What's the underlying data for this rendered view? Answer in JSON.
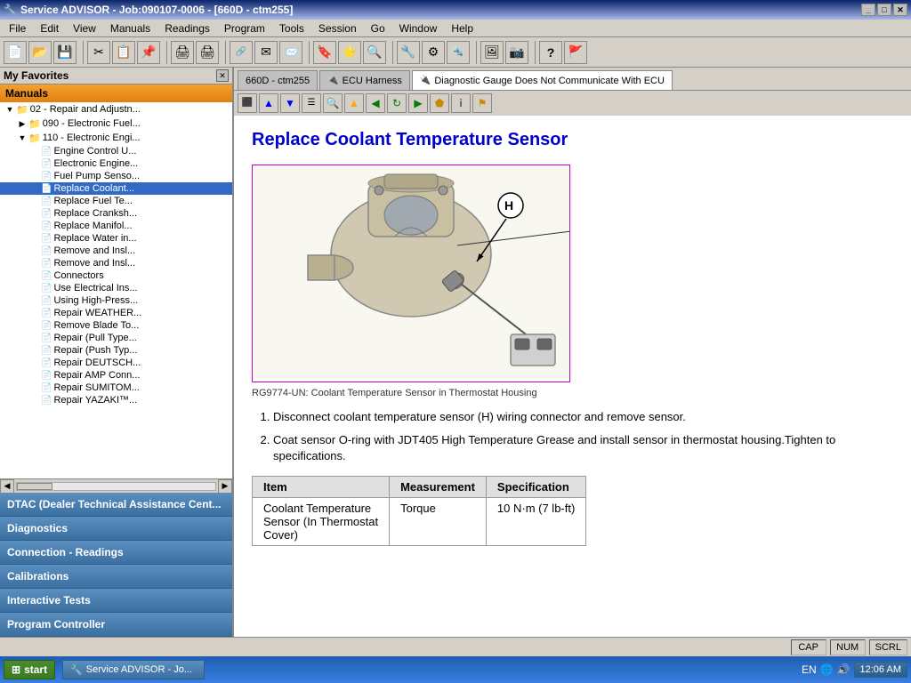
{
  "window": {
    "title": "Service ADVISOR - Job:090107-0006 - [660D - ctm255]",
    "icon": "🔧"
  },
  "menu": {
    "items": [
      "File",
      "Edit",
      "View",
      "Manuals",
      "Readings",
      "Program",
      "Tools",
      "Session",
      "Go",
      "Window",
      "Help"
    ]
  },
  "tabs": [
    {
      "label": "660D - ctm255",
      "active": false
    },
    {
      "label": "ECU Harness",
      "active": false
    },
    {
      "label": "Diagnostic Gauge Does Not Communicate With ECU",
      "active": true
    }
  ],
  "left_panel": {
    "title": "My Favorites",
    "manuals_label": "Manuals",
    "tree": [
      {
        "level": 0,
        "type": "folder",
        "expanded": true,
        "text": "02 - Repair and Adjustn..."
      },
      {
        "level": 1,
        "type": "folder",
        "expanded": false,
        "text": "090 - Electronic Fuel..."
      },
      {
        "level": 1,
        "type": "folder",
        "expanded": true,
        "text": "110 - Electronic Engi..."
      },
      {
        "level": 2,
        "type": "doc",
        "text": "Engine Control U..."
      },
      {
        "level": 2,
        "type": "doc",
        "text": "Electronic Engine..."
      },
      {
        "level": 2,
        "type": "doc",
        "text": "Fuel Pump Senso..."
      },
      {
        "level": 2,
        "type": "doc",
        "text": "Replace Coolant...",
        "selected": true
      },
      {
        "level": 2,
        "type": "doc",
        "text": "Replace Fuel Te..."
      },
      {
        "level": 2,
        "type": "doc",
        "text": "Replace Cranksh..."
      },
      {
        "level": 2,
        "type": "doc",
        "text": "Replace Manifol..."
      },
      {
        "level": 2,
        "type": "doc",
        "text": "Replace Water in..."
      },
      {
        "level": 2,
        "type": "doc",
        "text": "Remove and Insl..."
      },
      {
        "level": 2,
        "type": "doc",
        "text": "Remove and Insl..."
      },
      {
        "level": 2,
        "type": "doc",
        "text": "Connectors"
      },
      {
        "level": 2,
        "type": "doc",
        "text": "Use Electrical Ins..."
      },
      {
        "level": 2,
        "type": "doc",
        "text": "Using High-Press..."
      },
      {
        "level": 2,
        "type": "doc",
        "text": "Repair WEATHER..."
      },
      {
        "level": 2,
        "type": "doc",
        "text": "Remove Blade To..."
      },
      {
        "level": 2,
        "type": "doc",
        "text": "Repair (Pull Type..."
      },
      {
        "level": 2,
        "type": "doc",
        "text": "Repair (Push Typ..."
      },
      {
        "level": 2,
        "type": "doc",
        "text": "Repair DEUTSCH..."
      },
      {
        "level": 2,
        "type": "doc",
        "text": "Repair AMP Conn..."
      },
      {
        "level": 2,
        "type": "doc",
        "text": "Repair SUMITOM..."
      },
      {
        "level": 2,
        "type": "doc",
        "text": "Repair YAZAKI™..."
      }
    ],
    "bottom_buttons": [
      {
        "label": "DTAC (Dealer Technical Assistance Cent..."
      },
      {
        "label": "Diagnostics"
      },
      {
        "label": "Connection - Readings"
      },
      {
        "label": "Calibrations"
      },
      {
        "label": "Interactive Tests"
      },
      {
        "label": "Program Controller"
      }
    ]
  },
  "content": {
    "title": "Replace Coolant Temperature Sensor",
    "figure_caption": "RG9774-UN: Coolant Temperature Sensor in Thermostat Housing",
    "steps": [
      "Disconnect coolant temperature sensor (H) wiring connector and remove sensor.",
      "Coat sensor O-ring with JDT405 High Temperature Grease and install sensor in thermostat housing.Tighten to specifications."
    ],
    "table": {
      "headers": [
        "Item",
        "Measurement",
        "Specification"
      ],
      "rows": [
        [
          "Coolant Temperature\nSensor (In Thermostat\nCover)",
          "Torque",
          "10 N·m (7 lb-ft)"
        ]
      ]
    }
  },
  "status_bar": {
    "caps": "CAP",
    "num": "NUM",
    "scrl": "SCRL"
  },
  "taskbar": {
    "start_label": "start",
    "language": "EN",
    "time": "12:06 AM",
    "items": [
      {
        "label": "Service ADVISOR - Jo..."
      }
    ]
  }
}
